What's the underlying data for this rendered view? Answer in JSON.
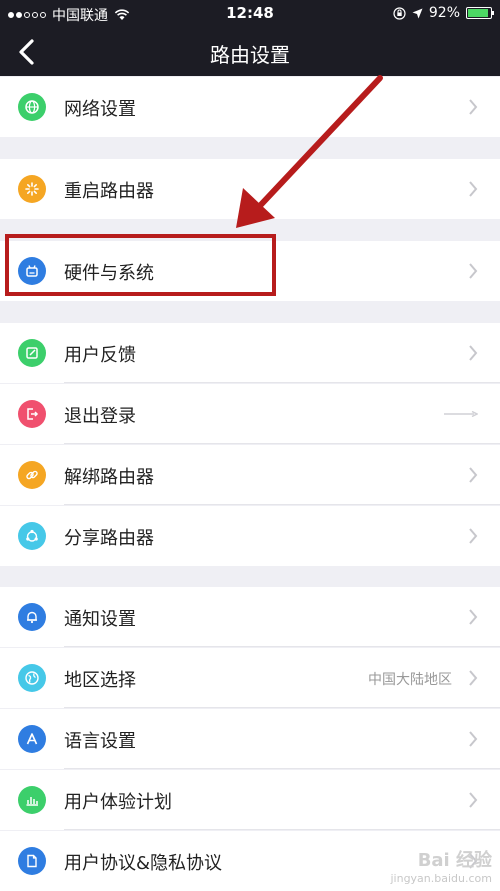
{
  "status_bar": {
    "carrier": "中国联通",
    "time": "12:48",
    "battery": "92%",
    "signal_bars_full": 2,
    "signal_bars_total": 5
  },
  "nav": {
    "title": "路由设置",
    "back_icon": "chevron-left-icon"
  },
  "settings": {
    "network": {
      "label": "网络设置",
      "icon": "globe-icon",
      "color": "#3ccf6b"
    },
    "restart": {
      "label": "重启路由器",
      "icon": "sparkle-icon",
      "color": "#f5a623"
    },
    "hardware": {
      "label": "硬件与系统",
      "icon": "router-icon",
      "color": "#2f7de1"
    },
    "feedback": {
      "label": "用户反馈",
      "icon": "edit-icon",
      "color": "#3ccf6b"
    },
    "logout": {
      "label": "退出登录",
      "icon": "exit-icon",
      "color": "#f0506e"
    },
    "unbind": {
      "label": "解绑路由器",
      "icon": "link-icon",
      "color": "#f5a623"
    },
    "share": {
      "label": "分享路由器",
      "icon": "share-icon",
      "color": "#46c8e8"
    },
    "notify": {
      "label": "通知设置",
      "icon": "bell-icon",
      "color": "#2f7de1"
    },
    "region": {
      "label": "地区选择",
      "value": "中国大陆地区",
      "icon": "globe-region-icon",
      "color": "#46c8e8"
    },
    "language": {
      "label": "语言设置",
      "icon": "letter-a-icon",
      "color": "#2f7de1"
    },
    "experience": {
      "label": "用户体验计划",
      "icon": "bar-chart-icon",
      "color": "#3ccf6b"
    },
    "privacy": {
      "label": "用户协议&隐私协议",
      "icon": "document-icon",
      "color": "#2f7de1"
    }
  },
  "annotation": {
    "highlight_color": "#b71c1c"
  },
  "watermark": {
    "brand": "Bai 经验",
    "url": "jingyan.baidu.com"
  }
}
